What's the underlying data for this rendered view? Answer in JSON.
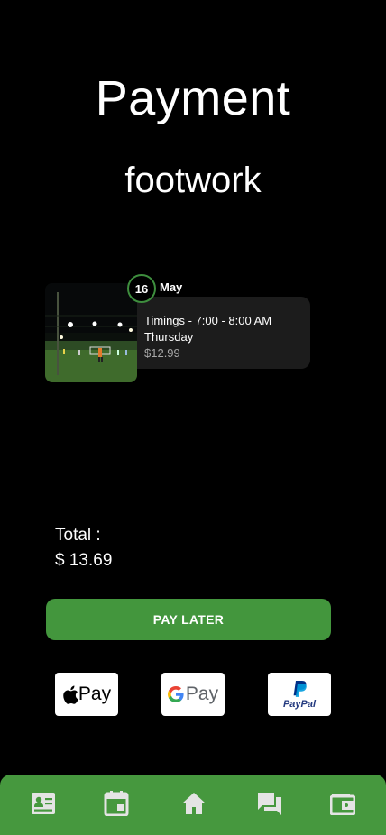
{
  "header": {
    "title": "Payment",
    "subtitle": "footwork"
  },
  "booking": {
    "day": "16",
    "month": "May",
    "timings": "Timings - 7:00 - 8:00 AM",
    "weekday": "Thursday",
    "price": "$12.99"
  },
  "summary": {
    "total_label": "Total :",
    "total_value": "$ 13.69"
  },
  "actions": {
    "pay_later_label": "PAY LATER"
  },
  "payment_methods": {
    "apple_label": "Pay",
    "google_label": "Pay",
    "paypal_label": "PayPal"
  },
  "bottom_nav": {
    "items": [
      {
        "icon": "id-card-icon"
      },
      {
        "icon": "calendar-icon"
      },
      {
        "icon": "home-icon"
      },
      {
        "icon": "chat-icon"
      },
      {
        "icon": "wallet-icon"
      }
    ]
  },
  "colors": {
    "background": "#000000",
    "accent_green": "#43963d",
    "card_bg": "#1c1c1c",
    "nav_icon": "#e4e4e4"
  }
}
